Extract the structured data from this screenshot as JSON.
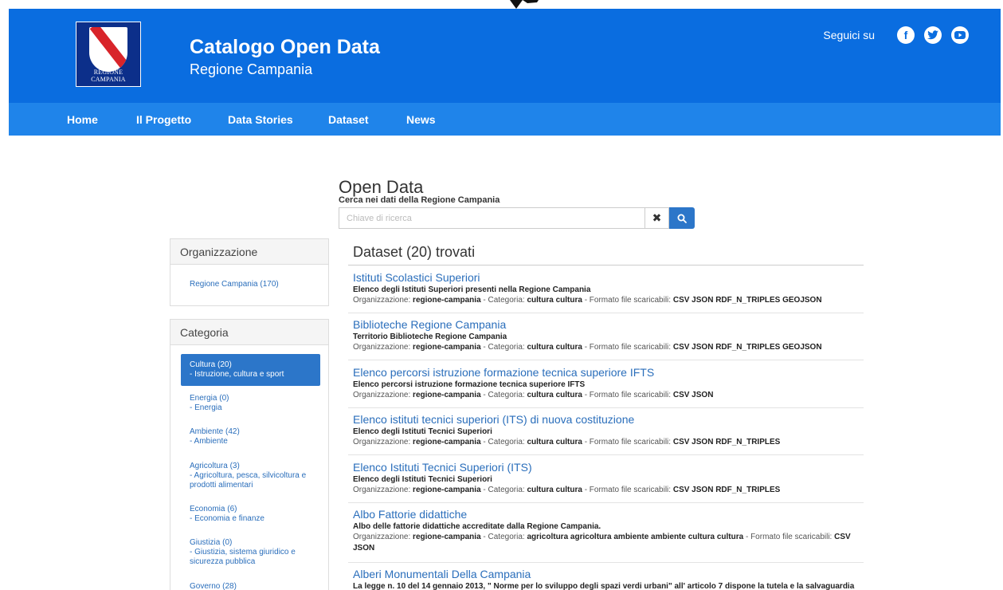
{
  "header": {
    "logo_text": "REGIONE CAMPANIA",
    "title": "Catalogo Open Data",
    "subtitle": "Regione Campania",
    "follow_label": "Seguici su",
    "socials": [
      "facebook-icon",
      "twitter-icon",
      "youtube-icon"
    ]
  },
  "nav": {
    "home": "Home",
    "progetto": "Il Progetto",
    "stories": "Data Stories",
    "dataset": "Dataset",
    "news": "News"
  },
  "search": {
    "title": "Open Data",
    "subtitle": "Cerca nei dati della Regione Campania",
    "placeholder": "Chiave di ricerca",
    "clear_glyph": "✖"
  },
  "sidebar": {
    "org_title": "Organizzazione",
    "org_item": "Regione Campania (170)",
    "cat_title": "Categoria",
    "categories": [
      {
        "name": "Cultura (20)",
        "desc": "- Istruzione, cultura e sport"
      },
      {
        "name": "Energia (0)",
        "desc": "- Energia"
      },
      {
        "name": "Ambiente (42)",
        "desc": "- Ambiente"
      },
      {
        "name": "Agricoltura (3)",
        "desc": "- Agricoltura, pesca, silvicoltura e prodotti alimentari"
      },
      {
        "name": "Economia (6)",
        "desc": "- Economia e finanze"
      },
      {
        "name": "Giustizia (0)",
        "desc": "- Giustizia, sistema giuridico e sicurezza pubblica"
      },
      {
        "name": "Governo (28)",
        "desc": ""
      }
    ]
  },
  "results": {
    "title": "Dataset (20) trovati",
    "labels": {
      "org": "Organizzazione: ",
      "cat": " - Categoria: ",
      "fmt": " - Formato file scaricabili: "
    },
    "items": [
      {
        "title": "Istituti Scolastici Superiori",
        "desc": "Elenco degli Istituti Superiori presenti nella Regione Campania",
        "org": "regione-campania",
        "cat": "cultura cultura",
        "fmt": "CSV JSON RDF_N_TRIPLES GEOJSON"
      },
      {
        "title": "Biblioteche Regione Campania",
        "desc": "Territorio Biblioteche Regione Campania",
        "org": "regione-campania",
        "cat": "cultura cultura",
        "fmt": "CSV JSON RDF_N_TRIPLES GEOJSON"
      },
      {
        "title": "Elenco percorsi istruzione formazione tecnica superiore IFTS",
        "desc": "Elenco percorsi istruzione formazione tecnica superiore IFTS",
        "org": "regione-campania",
        "cat": "cultura cultura",
        "fmt": "CSV JSON"
      },
      {
        "title": "Elenco istituti tecnici superiori (ITS) di nuova costituzione",
        "desc": "Elenco degli Istituti Tecnici Superiori",
        "org": "regione-campania",
        "cat": "cultura cultura",
        "fmt": "CSV JSON RDF_N_TRIPLES"
      },
      {
        "title": "Elenco Istituti Tecnici Superiori (ITS)",
        "desc": "Elenco degli Istituti Tecnici Superiori",
        "org": "regione-campania",
        "cat": "cultura cultura",
        "fmt": "CSV JSON RDF_N_TRIPLES"
      },
      {
        "title": "Albo Fattorie didattiche",
        "desc": "Albo delle fattorie didattiche accreditate dalla Regione Campania.",
        "org": "regione-campania",
        "cat": "agricoltura agricoltura ambiente ambiente cultura cultura",
        "fmt": "CSV JSON"
      },
      {
        "title": "Alberi Monumentali Della Campania",
        "desc": "La legge n. 10 del 14 gennaio 2013, \" Norme per lo sviluppo degli spazi verdi urbani\" all' articolo 7 dispone la tutela e la salvaguardia",
        "org": "",
        "cat": "",
        "fmt": ""
      }
    ]
  }
}
